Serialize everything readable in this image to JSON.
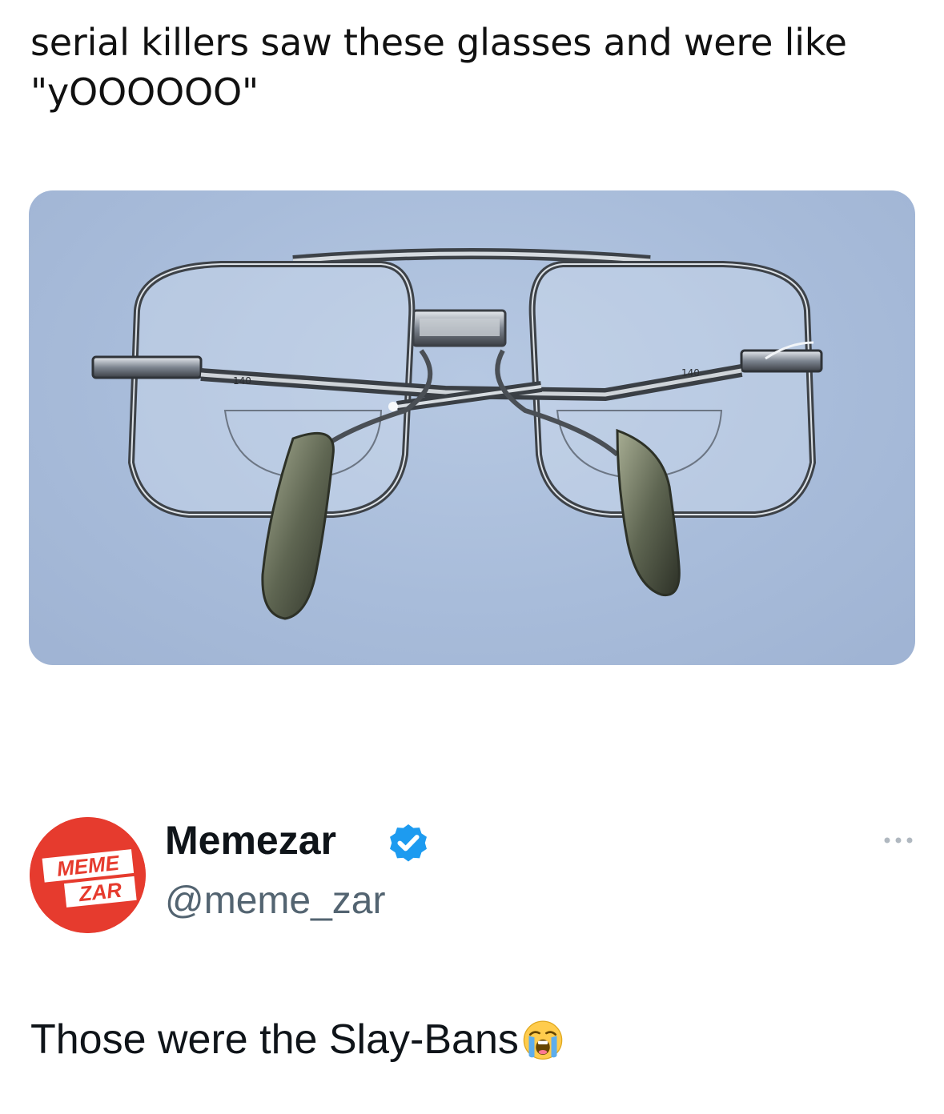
{
  "meme": {
    "caption": "serial killers saw these glasses and were like \"yOOOOOO\""
  },
  "photo": {
    "description_icon": "aviator-glasses-image",
    "temple_marking_left": "140",
    "temple_marking_right": "140",
    "background_color": "#a9bdda"
  },
  "author": {
    "display_name": "Memezar",
    "handle": "@meme_zar",
    "verified": true,
    "avatar_text_top": "MEME",
    "avatar_text_bottom": "ZAR",
    "avatar_color": "#e63b2e",
    "verified_color": "#1d9bf0"
  },
  "reply": {
    "text": "Those were the Slay-Bans",
    "emoji": "loudly-crying-face-icon"
  },
  "menu": {
    "more_icon": "more-options-icon"
  }
}
